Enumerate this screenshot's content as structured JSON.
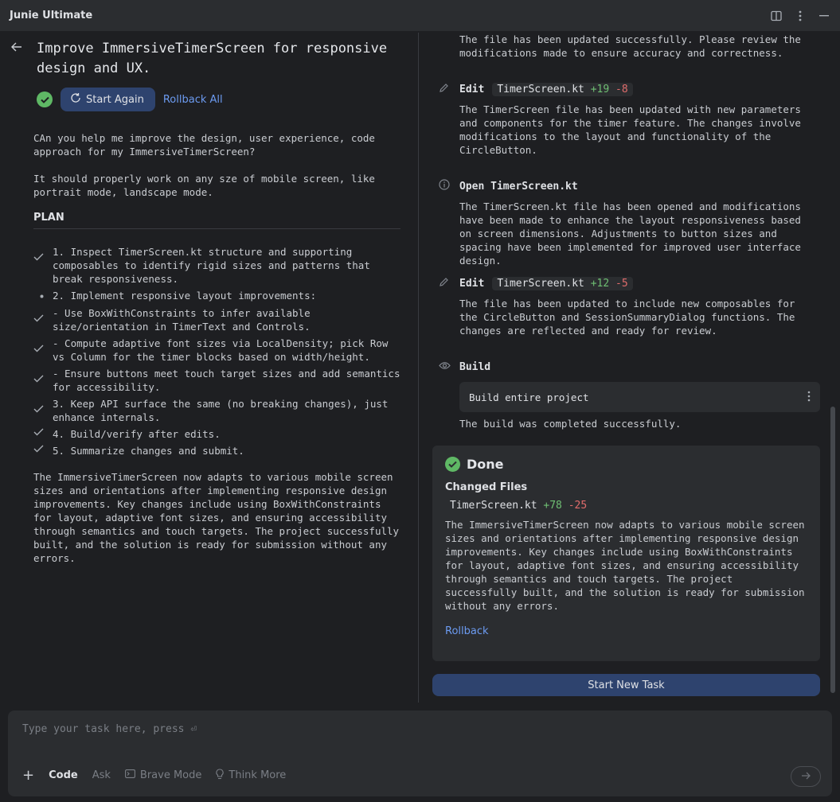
{
  "window": {
    "title": "Junie Ultimate"
  },
  "task": {
    "title": "Improve ImmersiveTimerScreen for responsive design and UX.",
    "start_again_label": "Start Again",
    "rollback_all_label": "Rollback All",
    "prompt": [
      "CAn you help me improve the design, user experience, code approach for my ImmersiveTimerScreen?",
      "It should properly work on any sze of mobile screen, like portrait mode, landscape mode."
    ],
    "plan_heading": "PLAN",
    "plan_items": [
      {
        "text": "1. Inspect TimerScreen.kt structure and supporting composables to identify rigid sizes and patterns that break responsiveness.",
        "mark": "check"
      },
      {
        "text": "2. Implement responsive layout improvements:",
        "mark": "bullet"
      },
      {
        "text": "- Use BoxWithConstraints to infer available size/orientation in TimerText and Controls.",
        "mark": "check"
      },
      {
        "text": "- Compute adaptive font sizes via LocalDensity; pick Row vs Column for the timer blocks based on width/height.",
        "mark": "check"
      },
      {
        "text": "- Ensure buttons meet touch target sizes and add semantics for accessibility.",
        "mark": "check"
      },
      {
        "text": "3. Keep API surface the same (no breaking changes), just enhance internals.",
        "mark": "check"
      },
      {
        "text": "4. Build/verify after edits.",
        "mark": "check"
      },
      {
        "text": "5. Summarize changes and submit.",
        "mark": "check"
      }
    ],
    "summary": "The ImmersiveTimerScreen now adapts to various mobile screen sizes and orientations after implementing responsive design improvements. Key changes include using BoxWithConstraints for layout, adaptive font sizes, and ensuring accessibility through semantics and touch targets. The project successfully built, and the solution is ready for submission without any errors."
  },
  "steps": {
    "top_text": "The file has been updated successfully. Please review the modifications made to ensure accuracy and correctness.",
    "edit1": {
      "label": "Edit",
      "file": "TimerScreen.kt",
      "add": "+19",
      "del": "-8",
      "text": "The TimerScreen file has been updated with new parameters and components for the timer feature. The changes involve modifications to the layout and functionality of the CircleButton."
    },
    "open1": {
      "label": "Open TimerScreen.kt",
      "text": "The TimerScreen.kt file has been opened and modifications have been made to enhance the layout responsiveness based on screen dimensions. Adjustments to button sizes and spacing have been implemented for improved user interface design."
    },
    "edit2": {
      "label": "Edit",
      "file": "TimerScreen.kt",
      "add": "+12",
      "del": "-5",
      "text": "The file has been updated to include new composables for the CircleButton and SessionSummaryDialog functions. The changes are reflected and ready for review."
    },
    "build": {
      "label": "Build",
      "command": "Build entire project",
      "text": "The build was completed successfully."
    }
  },
  "done": {
    "title": "Done",
    "changed_files_heading": "Changed Files",
    "file": "TimerScreen.kt",
    "add": "+78",
    "del": "-25",
    "text": "The ImmersiveTimerScreen now adapts to various mobile screen sizes and orientations after implementing responsive design improvements. Key changes include using BoxWithConstraints for layout, adaptive font sizes, and ensuring accessibility through semantics and touch targets. The project successfully built, and the solution is ready for submission without any errors.",
    "rollback_label": "Rollback",
    "start_new_label": "Start New Task"
  },
  "input": {
    "placeholder": "Type your task here, press ⏎",
    "mode_code": "Code",
    "mode_ask": "Ask",
    "brave_mode": "Brave Mode",
    "think_more": "Think More"
  }
}
